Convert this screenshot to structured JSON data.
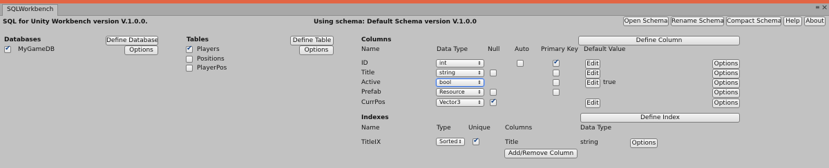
{
  "window": {
    "tab": "SQLWorkbench",
    "menu_icon": "≡",
    "close_icon": "×"
  },
  "header": {
    "title": "SQL for Unity Workbench version V.1.0.0.",
    "schema_status": "Using schema: Default Schema version V.1.0.0",
    "buttons": {
      "open": "Open Schema",
      "rename": "Rename Schema",
      "compact": "Compact Schema",
      "help": "Help",
      "about": "About"
    }
  },
  "databases": {
    "heading": "Databases",
    "define_button": "Define Database",
    "options_button": "Options",
    "items": [
      {
        "name": "MyGameDB",
        "checked": true
      }
    ]
  },
  "tables": {
    "heading": "Tables",
    "define_button": "Define Table",
    "options_button": "Options",
    "items": [
      {
        "name": "Players",
        "checked": true
      },
      {
        "name": "Positions",
        "checked": false
      },
      {
        "name": "PlayerPos",
        "checked": false
      }
    ]
  },
  "columns": {
    "heading": "Columns",
    "define_button": "Define Column",
    "headers": {
      "name": "Name",
      "type": "Data Type",
      "null": "Null",
      "auto": "Auto",
      "pk": "Primary Key",
      "default": "Default Value"
    },
    "edit_label": "Edit",
    "options_label": "Options",
    "rows": [
      {
        "name": "ID",
        "type": "int",
        "null_check": false,
        "auto_check": true,
        "pk_check": true,
        "default": "",
        "edit": true
      },
      {
        "name": "Title",
        "type": "string",
        "null_check": true,
        "auto_check": false,
        "pk_check": true,
        "default": "",
        "edit": true
      },
      {
        "name": "Active",
        "type": "bool",
        "null_check": false,
        "auto_check": false,
        "pk_check": true,
        "default": "true",
        "edit": true
      },
      {
        "name": "Prefab",
        "type": "Resource",
        "null_check": true,
        "auto_check": false,
        "pk_check": true,
        "default": "",
        "edit": false
      },
      {
        "name": "CurrPos",
        "type": "Vector3",
        "null_check": true,
        "auto_check": false,
        "pk_check": false,
        "default": "",
        "edit": true
      }
    ]
  },
  "indexes": {
    "heading": "Indexes",
    "define_button": "Define Index",
    "headers": {
      "name": "Name",
      "type": "Type",
      "unique": "Unique",
      "columns": "Columns",
      "data_type": "Data Type"
    },
    "rows": [
      {
        "name": "TitleIX",
        "type": "Sorted",
        "unique": true,
        "column": "Title",
        "data_type": "string",
        "options": "Options"
      }
    ],
    "add_remove_button": "Add/Remove Column"
  }
}
